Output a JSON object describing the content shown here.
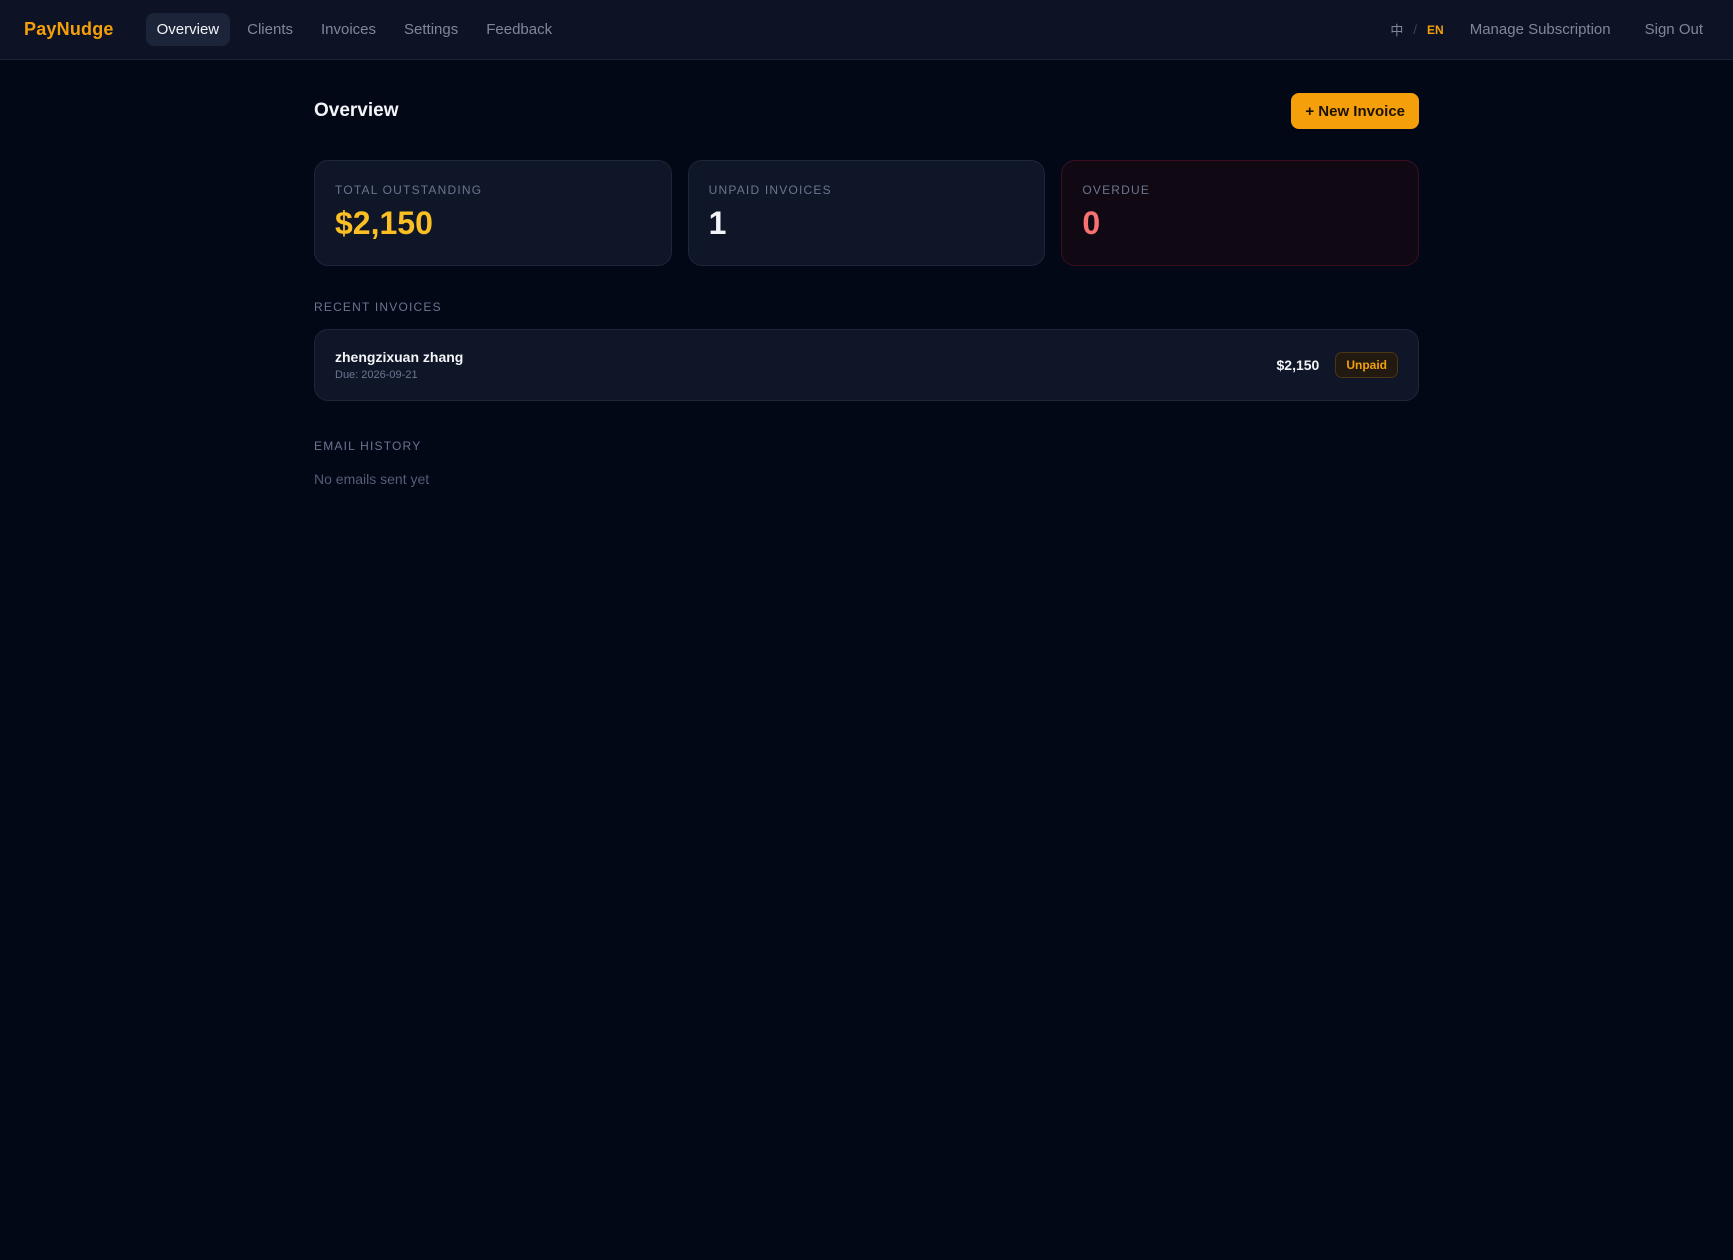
{
  "app": {
    "brand": "PayNudge"
  },
  "nav": {
    "items": [
      {
        "label": "Overview",
        "active": true
      },
      {
        "label": "Clients",
        "active": false
      },
      {
        "label": "Invoices",
        "active": false
      },
      {
        "label": "Settings",
        "active": false
      },
      {
        "label": "Feedback",
        "active": false
      }
    ],
    "lang_zh": "中",
    "lang_sep": "/",
    "lang_en": "EN",
    "manage_subscription": "Manage Subscription",
    "sign_out": "Sign Out"
  },
  "page": {
    "title": "Overview",
    "new_invoice_label": "+ New Invoice"
  },
  "stats": {
    "total_outstanding": {
      "label": "TOTAL OUTSTANDING",
      "value": "$2,150"
    },
    "unpaid_invoices": {
      "label": "UNPAID INVOICES",
      "value": "1"
    },
    "overdue": {
      "label": "OVERDUE",
      "value": "0"
    }
  },
  "recent_invoices": {
    "label": "RECENT INVOICES",
    "items": [
      {
        "client": "zhengzixuan zhang",
        "due": "Due: 2026-09-21",
        "amount": "$2,150",
        "status": "Unpaid"
      }
    ]
  },
  "email_history": {
    "label": "EMAIL HISTORY",
    "empty_text": "No emails sent yet"
  },
  "colors": {
    "accent": "#f59f0b",
    "background": "#030817",
    "danger": "#f87171"
  }
}
